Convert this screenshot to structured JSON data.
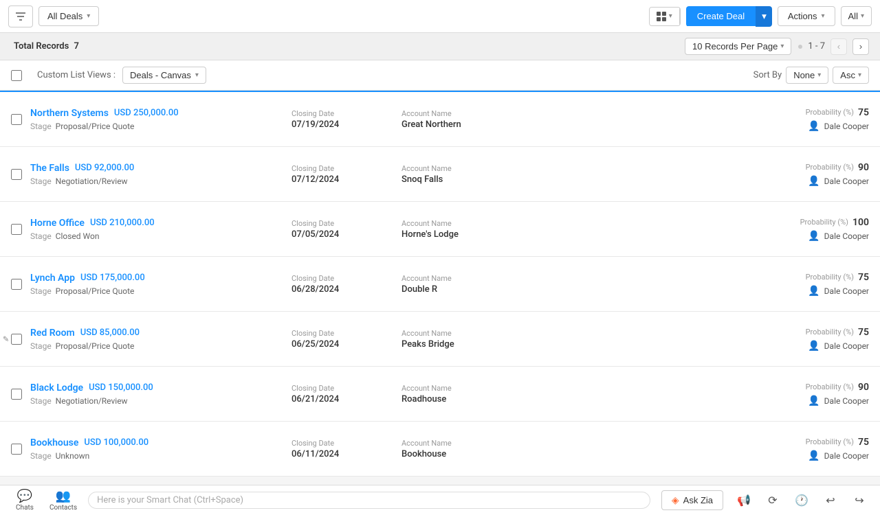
{
  "toolbar": {
    "filter_label": "All Deals",
    "create_deal_label": "Create Deal",
    "actions_label": "Actions",
    "all_label": "All"
  },
  "records_bar": {
    "total_label": "Total Records",
    "total_count": "7",
    "per_page_label": "10 Records Per Page",
    "page_range": "1 - 7"
  },
  "list_view": {
    "custom_views_label": "Custom List Views :",
    "views_dropdown": "Deals - Canvas",
    "sort_by_label": "Sort By",
    "sort_value": "None",
    "sort_order": "Asc"
  },
  "deals": [
    {
      "id": 1,
      "name": "Northern Systems",
      "amount": "USD 250,000.00",
      "stage_label": "Stage",
      "stage": "Proposal/Price Quote",
      "closing_date_label": "Closing Date",
      "closing_date": "07/19/2024",
      "account_name_label": "Account Name",
      "account_name": "Great Northern",
      "probability_label": "Probability (%)",
      "probability": "75",
      "owner": "Dale Cooper"
    },
    {
      "id": 2,
      "name": "The Falls",
      "amount": "USD 92,000.00",
      "stage_label": "Stage",
      "stage": "Negotiation/Review",
      "closing_date_label": "Closing Date",
      "closing_date": "07/12/2024",
      "account_name_label": "Account Name",
      "account_name": "Snoq Falls",
      "probability_label": "Probability (%)",
      "probability": "90",
      "owner": "Dale Cooper"
    },
    {
      "id": 3,
      "name": "Horne Office",
      "amount": "USD 210,000.00",
      "stage_label": "Stage",
      "stage": "Closed Won",
      "closing_date_label": "Closing Date",
      "closing_date": "07/05/2024",
      "account_name_label": "Account Name",
      "account_name": "Horne's Lodge",
      "probability_label": "Probability (%)",
      "probability": "100",
      "owner": "Dale Cooper"
    },
    {
      "id": 4,
      "name": "Lynch App",
      "amount": "USD 175,000.00",
      "stage_label": "Stage",
      "stage": "Proposal/Price Quote",
      "closing_date_label": "Closing Date",
      "closing_date": "06/28/2024",
      "account_name_label": "Account Name",
      "account_name": "Double R",
      "probability_label": "Probability (%)",
      "probability": "75",
      "owner": "Dale Cooper"
    },
    {
      "id": 5,
      "name": "Red Room",
      "amount": "USD 85,000.00",
      "stage_label": "Stage",
      "stage": "Proposal/Price Quote",
      "closing_date_label": "Closing Date",
      "closing_date": "06/25/2024",
      "account_name_label": "Account Name",
      "account_name": "Peaks Bridge",
      "probability_label": "Probability (%)",
      "probability": "75",
      "owner": "Dale Cooper",
      "show_pencil": true
    },
    {
      "id": 6,
      "name": "Black Lodge",
      "amount": "USD 150,000.00",
      "stage_label": "Stage",
      "stage": "Negotiation/Review",
      "closing_date_label": "Closing Date",
      "closing_date": "06/21/2024",
      "account_name_label": "Account Name",
      "account_name": "Roadhouse",
      "probability_label": "Probability (%)",
      "probability": "90",
      "owner": "Dale Cooper"
    },
    {
      "id": 7,
      "name": "Bookhouse",
      "amount": "USD 100,000.00",
      "stage_label": "Stage",
      "stage": "Unknown",
      "closing_date_label": "Closing Date",
      "closing_date": "06/11/2024",
      "account_name_label": "Account Name",
      "account_name": "Bookhouse",
      "probability_label": "Probability (%)",
      "probability": "75",
      "owner": "Dale Cooper"
    }
  ],
  "bottom_bar": {
    "chats_label": "Chats",
    "contacts_label": "Contacts",
    "chat_placeholder": "Here is your Smart Chat (Ctrl+Space)",
    "ask_zia_label": "Ask Zia"
  },
  "icons": {
    "filter": "⚡",
    "chevron_down": "▾",
    "grid": "⊞",
    "list": "☰",
    "plus": "+",
    "chevron_left": "‹",
    "chevron_right": "›",
    "pencil": "✎",
    "user": "👤",
    "chat": "💬",
    "contacts": "👥",
    "megaphone": "📢",
    "refresh": "⟳",
    "clock": "🕐",
    "undo": "↩",
    "redo": "↪"
  }
}
